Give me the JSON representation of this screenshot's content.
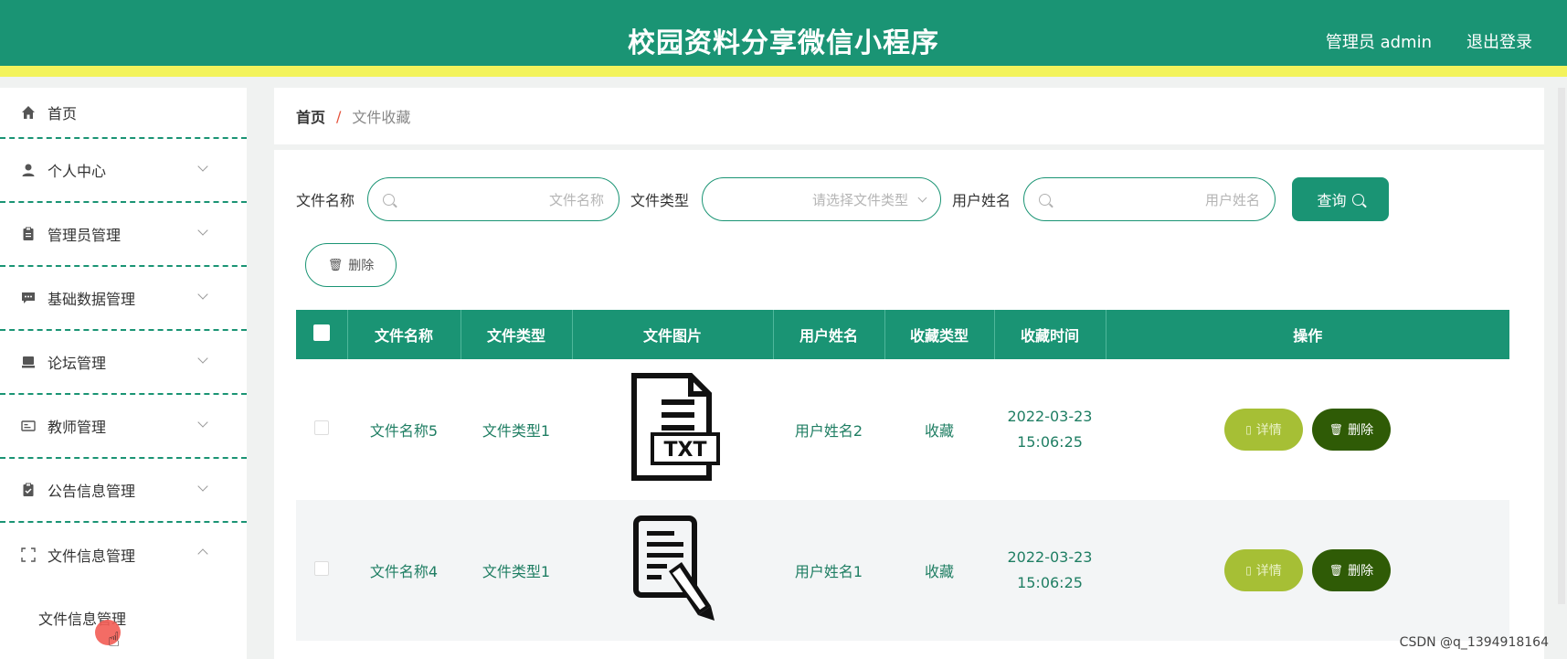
{
  "header": {
    "title": "校园资料分享微信小程序",
    "user": "管理员 admin",
    "logout": "退出登录"
  },
  "sidebar": {
    "items": [
      {
        "label": "首页",
        "icon": "home-icon"
      },
      {
        "label": "个人中心",
        "icon": "user-icon"
      },
      {
        "label": "管理员管理",
        "icon": "clipboard-icon"
      },
      {
        "label": "基础数据管理",
        "icon": "chat-icon"
      },
      {
        "label": "论坛管理",
        "icon": "monitor-icon"
      },
      {
        "label": "教师管理",
        "icon": "id-card-icon"
      },
      {
        "label": "公告信息管理",
        "icon": "checklist-icon"
      },
      {
        "label": "文件信息管理",
        "icon": "scan-icon"
      }
    ],
    "submenu": {
      "label": "文件信息管理"
    }
  },
  "breadcrumb": {
    "home": "首页",
    "sep": "/",
    "current": "文件收藏"
  },
  "search": {
    "file_name_label": "文件名称",
    "file_name_placeholder": "文件名称",
    "file_type_label": "文件类型",
    "file_type_placeholder": "请选择文件类型",
    "user_name_label": "用户姓名",
    "user_name_placeholder": "用户姓名",
    "query_label": "查询"
  },
  "toolbar": {
    "delete_label": "删除"
  },
  "table": {
    "columns": [
      "文件名称",
      "文件类型",
      "文件图片",
      "用户姓名",
      "收藏类型",
      "收藏时间",
      "操作"
    ],
    "rows": [
      {
        "name": "文件名称5",
        "type": "文件类型1",
        "image": "txt-file-icon",
        "user": "用户姓名2",
        "fav": "收藏",
        "date": "2022-03-23",
        "time": "15:06:25"
      },
      {
        "name": "文件名称4",
        "type": "文件类型1",
        "image": "document-pen-icon",
        "user": "用户姓名1",
        "fav": "收藏",
        "date": "2022-03-23",
        "time": "15:06:25"
      }
    ],
    "detail_label": "详情",
    "delete_label": "删除"
  },
  "watermark": "CSDN @q_1394918164",
  "colors": {
    "primary": "#1a9474",
    "accent_bar": "#f3f35c",
    "detail_btn": "#a6bf35",
    "delete_btn": "#2f5b06"
  }
}
